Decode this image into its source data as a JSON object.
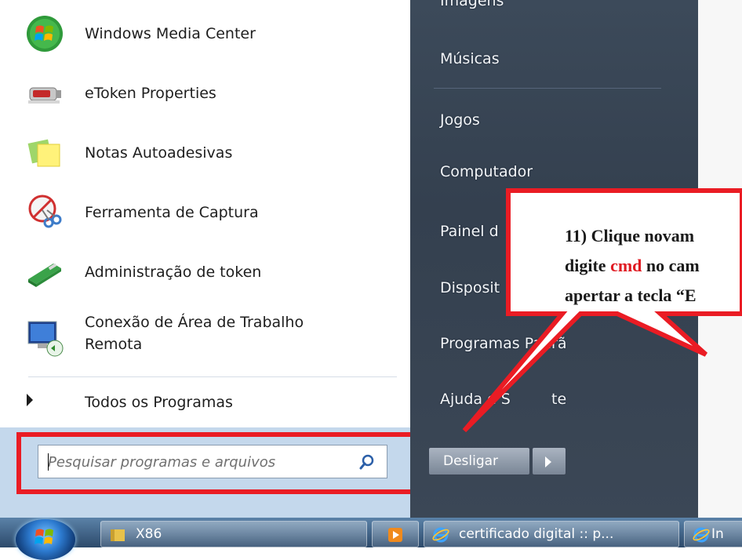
{
  "start_menu": {
    "programs": [
      {
        "label": "Windows Media Center",
        "icon": "windows-media-center-icon"
      },
      {
        "label": "eToken Properties",
        "icon": "etoken-icon"
      },
      {
        "label": "Notas Autoadesivas",
        "icon": "sticky-notes-icon"
      },
      {
        "label": "Ferramenta de Captura",
        "icon": "snipping-tool-icon"
      },
      {
        "label": "Administração de token",
        "icon": "token-admin-icon"
      },
      {
        "label_line1": "Conexão de Área de Trabalho",
        "label_line2": "Remota",
        "icon": "remote-desktop-icon"
      }
    ],
    "all_programs": "Todos os Programas",
    "search": {
      "placeholder": "Pesquisar programas e arquivos"
    },
    "right_links": [
      {
        "label": "Imagens"
      },
      {
        "label": "Músicas"
      },
      {
        "label": "Jogos"
      },
      {
        "label": "Computador"
      },
      {
        "label": "Painel d"
      },
      {
        "label": "Disposit"
      },
      {
        "label": "Programas Padrã"
      },
      {
        "label": "Ajuda e S"
      }
    ],
    "right_link_fragment": "te",
    "shutdown": {
      "label": "Desligar"
    }
  },
  "callout": {
    "line1": "11) Clique novam",
    "line2_pre": "digite ",
    "line2_cmd": "cmd",
    "line2_post": " no cam",
    "line3": "apertar a tecla “E"
  },
  "taskbar": {
    "items": [
      {
        "label": "X86",
        "icon": "folder-icon"
      },
      {
        "label": "",
        "icon": "media-player-icon"
      },
      {
        "label": "certificado digital :: p...",
        "icon": "internet-explorer-icon"
      },
      {
        "label": "In",
        "icon": "internet-explorer-icon"
      }
    ]
  },
  "colors": {
    "highlight_red": "#ea1c24",
    "right_pane": "#3c4a5a",
    "search_panel": "#c4d8ec"
  }
}
